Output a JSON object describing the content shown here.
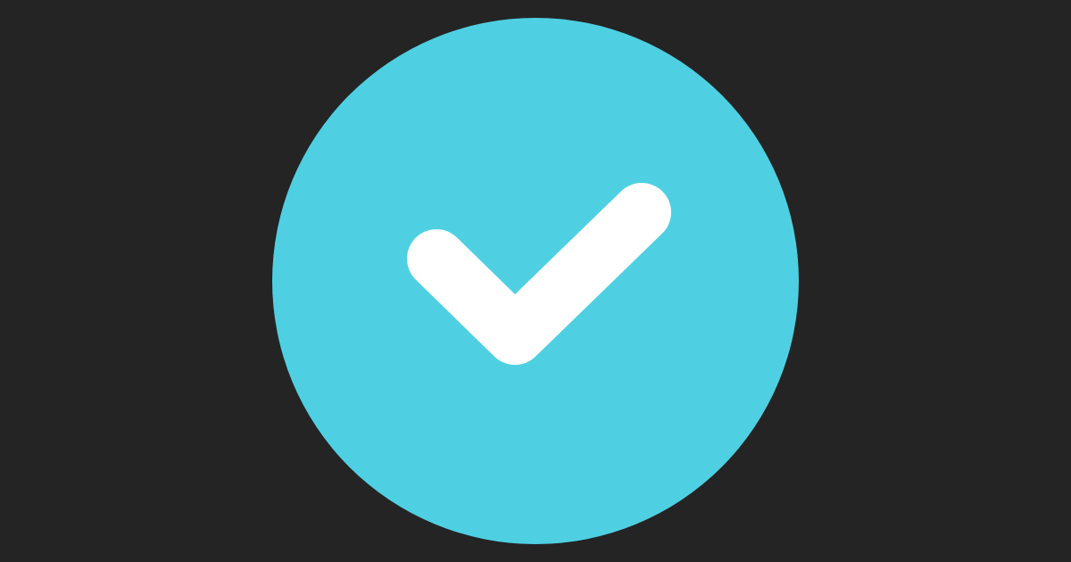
{
  "icon": {
    "name": "check-circle-icon",
    "status": "checked"
  },
  "colors": {
    "background": "#242424",
    "circle": "#4ED0E2",
    "checkmark": "#FFFFFF"
  }
}
